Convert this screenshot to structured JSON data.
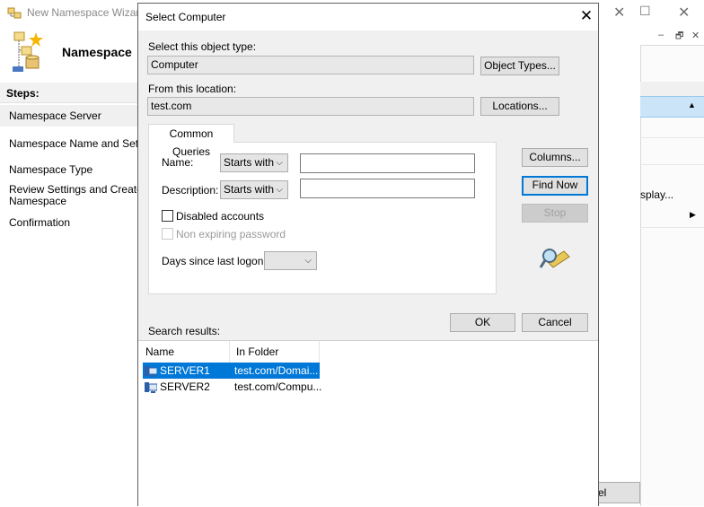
{
  "background_wizard": {
    "title": "New Namespace Wizard",
    "header": "Namespace",
    "steps_label": "Steps:",
    "steps": [
      "Namespace Server",
      "Namespace Name and Settings",
      "Namespace Type",
      "Review Settings and Create\nNamespace",
      "Confirmation"
    ],
    "cancel_fragment": "el"
  },
  "background_window": {
    "display_fragment": "splay..."
  },
  "dialog": {
    "title": "Select Computer",
    "object_type_label": "Select this object type:",
    "object_type_value": "Computer",
    "object_types_button": "Object Types...",
    "location_label": "From this location:",
    "location_value": "test.com",
    "locations_button": "Locations...",
    "tab_label": "Common Queries",
    "name_label": "Name:",
    "name_mode": "Starts with",
    "name_value": "",
    "description_label": "Description:",
    "description_mode": "Starts with",
    "description_value": "",
    "disabled_accounts_label": "Disabled accounts",
    "disabled_accounts_checked": false,
    "non_expiring_label": "Non expiring password",
    "days_since_logon_label": "Days since last logon:",
    "days_since_logon_value": "",
    "columns_button": "Columns...",
    "find_now_button": "Find Now",
    "stop_button": "Stop",
    "ok_button": "OK",
    "cancel_button": "Cancel",
    "search_results_label": "Search results:",
    "columns": [
      "Name",
      "In Folder"
    ],
    "results": [
      {
        "name": "SERVER1",
        "folder": "test.com/Domai...",
        "selected": true
      },
      {
        "name": "SERVER2",
        "folder": "test.com/Compu...",
        "selected": false
      }
    ]
  },
  "colors": {
    "selection": "#0078d7",
    "dialog_bg": "#f0f0f0"
  }
}
